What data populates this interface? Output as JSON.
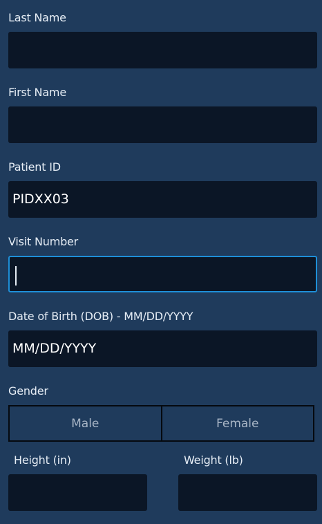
{
  "form": {
    "last_name": {
      "label": "Last Name",
      "value": ""
    },
    "first_name": {
      "label": "First Name",
      "value": ""
    },
    "patient_id": {
      "label": "Patient ID",
      "value": "PIDXX03"
    },
    "visit_number": {
      "label": "Visit Number",
      "value": ""
    },
    "dob": {
      "label": "Date of Birth (DOB) - MM/DD/YYYY",
      "placeholder": "MM/DD/YYYY"
    },
    "gender": {
      "label": "Gender",
      "options": [
        "Male",
        "Female"
      ]
    },
    "height": {
      "label": "Height (in)",
      "value": ""
    },
    "weight": {
      "label": "Weight (lb)",
      "value": ""
    }
  },
  "colors": {
    "background": "#1f3b5c",
    "field": "#0b1626",
    "focus_border": "#1e8fd8",
    "text": "#e6edf5",
    "muted_text": "#a9b6c6"
  }
}
